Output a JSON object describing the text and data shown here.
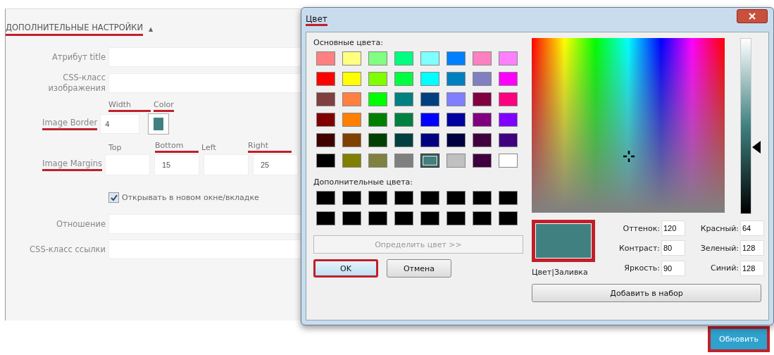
{
  "settings": {
    "heading": {
      "text": "ДОПОЛНИТЕЛЬНЫЕ НАСТРОЙКИ",
      "marked": true
    },
    "toggle": "▲",
    "fields_top": [
      {
        "label": "Атрибут title"
      },
      {
        "label": "CSS-класс изображения"
      }
    ],
    "image_border": {
      "label": "Image Border",
      "marked": true,
      "width": {
        "label": "Width",
        "marked": true,
        "value": "4"
      },
      "color": {
        "label": "Color",
        "marked": true,
        "color": "#408080"
      }
    },
    "image_margins": {
      "label": "Image Margins",
      "marked": true,
      "parts": [
        {
          "label": "Top",
          "marked": false
        },
        {
          "label": "Bottom",
          "marked": true,
          "value": "15"
        },
        {
          "label": "Left",
          "marked": false
        },
        {
          "label": "Right",
          "marked": true,
          "value": "25"
        }
      ]
    },
    "new_window": {
      "label": "Открывать в новом окне/вкладке",
      "checked": true
    },
    "fields_bottom": [
      {
        "label": "Отношение"
      },
      {
        "label": "CSS-класс ссылки"
      }
    ],
    "update_button": {
      "label": "Обновить",
      "marked": true
    }
  },
  "dialog": {
    "title": "Цвет",
    "title_marked": true,
    "basic_label": "Основные цвета:",
    "basic_colors": [
      {
        "color": "#ff8080",
        "selected": false
      },
      {
        "color": "#ffff80",
        "selected": false
      },
      {
        "color": "#80ff80",
        "selected": false
      },
      {
        "color": "#00ff80",
        "selected": false
      },
      {
        "color": "#80ffff",
        "selected": false
      },
      {
        "color": "#0080ff",
        "selected": false
      },
      {
        "color": "#ff80c0",
        "selected": false
      },
      {
        "color": "#ff80ff",
        "selected": false
      },
      {
        "color": "#ff0000",
        "selected": false
      },
      {
        "color": "#ffff00",
        "selected": false
      },
      {
        "color": "#80ff00",
        "selected": false
      },
      {
        "color": "#00ff40",
        "selected": false
      },
      {
        "color": "#00ffff",
        "selected": false
      },
      {
        "color": "#0080c0",
        "selected": false
      },
      {
        "color": "#8080c0",
        "selected": false
      },
      {
        "color": "#ff00ff",
        "selected": false
      },
      {
        "color": "#804040",
        "selected": false
      },
      {
        "color": "#ff8040",
        "selected": false
      },
      {
        "color": "#00ff00",
        "selected": false
      },
      {
        "color": "#008080",
        "selected": false
      },
      {
        "color": "#004080",
        "selected": false
      },
      {
        "color": "#8080ff",
        "selected": false
      },
      {
        "color": "#800040",
        "selected": false
      },
      {
        "color": "#ff0080",
        "selected": false
      },
      {
        "color": "#800000",
        "selected": false
      },
      {
        "color": "#ff8000",
        "selected": false
      },
      {
        "color": "#008000",
        "selected": false
      },
      {
        "color": "#008040",
        "selected": false
      },
      {
        "color": "#0000ff",
        "selected": false
      },
      {
        "color": "#0000a0",
        "selected": false
      },
      {
        "color": "#800080",
        "selected": false
      },
      {
        "color": "#8000ff",
        "selected": false
      },
      {
        "color": "#400000",
        "selected": false
      },
      {
        "color": "#804000",
        "selected": false
      },
      {
        "color": "#004000",
        "selected": false
      },
      {
        "color": "#004040",
        "selected": false
      },
      {
        "color": "#000080",
        "selected": false
      },
      {
        "color": "#000040",
        "selected": false
      },
      {
        "color": "#400040",
        "selected": false
      },
      {
        "color": "#400080",
        "selected": false
      },
      {
        "color": "#000000",
        "selected": false
      },
      {
        "color": "#808000",
        "selected": false
      },
      {
        "color": "#808040",
        "selected": false
      },
      {
        "color": "#808080",
        "selected": false
      },
      {
        "color": "#408080",
        "selected": true
      },
      {
        "color": "#c0c0c0",
        "selected": false
      },
      {
        "color": "#400040",
        "selected": false
      },
      {
        "color": "#ffffff",
        "selected": false
      }
    ],
    "custom_label": "Дополнительные цвета:",
    "custom_colors": [
      {
        "color": "#000000"
      },
      {
        "color": "#000000"
      },
      {
        "color": "#000000"
      },
      {
        "color": "#000000"
      },
      {
        "color": "#000000"
      },
      {
        "color": "#000000"
      },
      {
        "color": "#000000"
      },
      {
        "color": "#000000"
      },
      {
        "color": "#000000"
      },
      {
        "color": "#000000"
      },
      {
        "color": "#000000"
      },
      {
        "color": "#000000"
      },
      {
        "color": "#000000"
      },
      {
        "color": "#000000"
      },
      {
        "color": "#000000"
      },
      {
        "color": "#000000"
      }
    ],
    "define_button": {
      "label": "Определить цвет >>",
      "disabled": true
    },
    "ok_button": {
      "label": "OK",
      "marked": true
    },
    "cancel_button": {
      "label": "Отмена"
    },
    "luminance": {
      "level": 0.38
    },
    "preview": {
      "color": "#408080",
      "marked": true,
      "label": "Цвет|Заливка"
    },
    "values": [
      {
        "label": "Оттенок:",
        "value": "120"
      },
      {
        "label": "Красный:",
        "value": "64"
      },
      {
        "label": "Контраст:",
        "value": "80"
      },
      {
        "label": "Зеленый:",
        "value": "128"
      },
      {
        "label": "Яркость:",
        "value": "90"
      },
      {
        "label": "Синий:",
        "value": "128"
      }
    ],
    "add_button": {
      "label": "Добавить в набор"
    }
  }
}
